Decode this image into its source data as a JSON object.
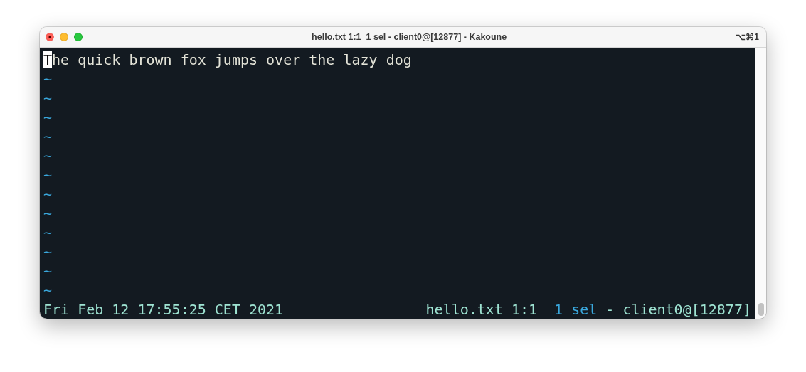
{
  "window": {
    "title": "hello.txt 1:1  1 sel - client0@[12877] - Kakoune",
    "shortcut": "⌥⌘1"
  },
  "buffer": {
    "cursor_text": "T",
    "rest_text": "he quick brown fox jumps over the lazy dog",
    "filler_lines": [
      "~",
      "~",
      "~",
      "~",
      "~",
      "~",
      "~",
      "~",
      "~",
      "~",
      "~",
      "~"
    ]
  },
  "status_bar": {
    "clock": "Fri Feb 12 17:55:25 CET 2021",
    "segments": [
      {
        "text": "hello.txt 1:1",
        "color": "#9ee3d2"
      },
      {
        "text": "1 sel",
        "color": "#3aa8dd"
      },
      {
        "text": "-",
        "color": "#9ee3d2"
      },
      {
        "text": "client0@[12877]",
        "color": "#9ee3d2"
      }
    ]
  }
}
